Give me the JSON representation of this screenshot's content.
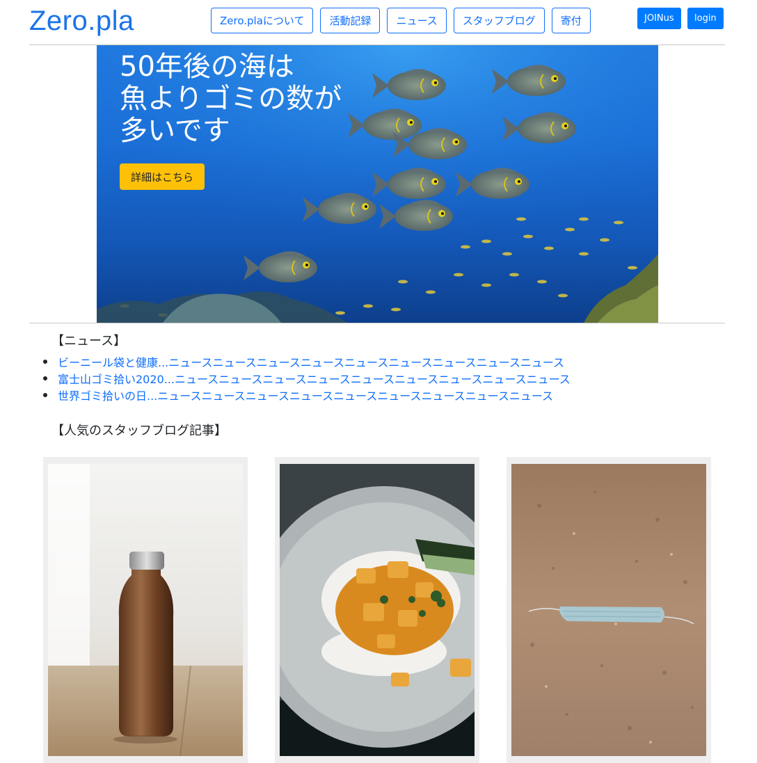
{
  "header": {
    "logo": "Zero.pla",
    "nav": [
      "Zero.plaについて",
      "活動記録",
      "ニュース",
      "スタッフブログ",
      "寄付"
    ],
    "join_label": "JOINus",
    "login_label": "login"
  },
  "hero": {
    "title_lines": [
      "50年後の海は",
      "魚よりゴミの数が",
      "多いです"
    ],
    "button_label": "詳細はこちら"
  },
  "news": {
    "heading": "【ニュース】",
    "items": [
      "ビーニール袋と健康...ニュースニュースニュースニュースニュースニュースニュースニュースニュース",
      "富士山ゴミ拾い2020...ニュースニュースニュースニュースニュースニュースニュースニュースニュース",
      "世界ゴミ拾いの日...ニュースニュースニュースニュースニュースニュースニュースニュースニュース"
    ]
  },
  "blog": {
    "heading": "【人気のスタッフブログ記事】"
  },
  "colors": {
    "accent": "#0d6efd",
    "cta": "#ffc107",
    "logo": "#1a73e8"
  }
}
